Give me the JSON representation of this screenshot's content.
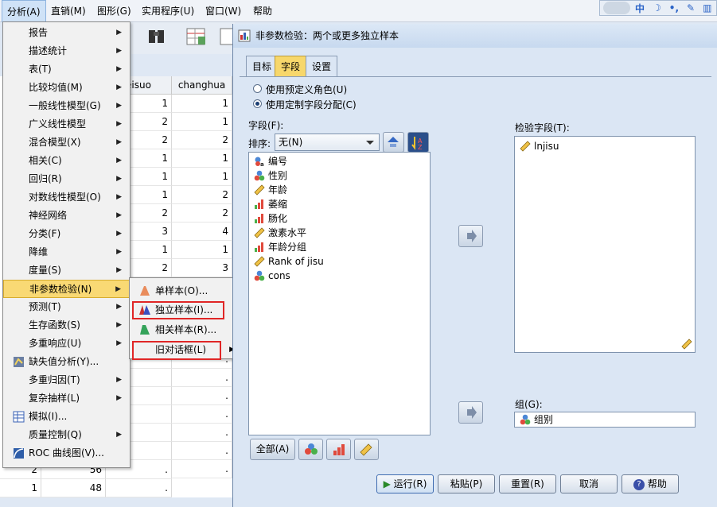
{
  "menubar": {
    "items": [
      "分析(A)",
      "直销(M)",
      "图形(G)",
      "实用程序(U)",
      "窗口(W)",
      "帮助"
    ],
    "ime_text": "中"
  },
  "grid": {
    "headers": [
      "eisuo",
      "changhua"
    ],
    "rows": [
      {
        "a": "1",
        "b": "1"
      },
      {
        "a": "2",
        "b": "1"
      },
      {
        "a": "2",
        "b": "2"
      },
      {
        "a": "1",
        "b": "1"
      },
      {
        "a": "1",
        "b": "1"
      },
      {
        "a": "1",
        "b": "2"
      },
      {
        "a": "2",
        "b": "2"
      },
      {
        "a": "3",
        "b": "4"
      },
      {
        "a": "1",
        "b": "1"
      },
      {
        "a": "2",
        "b": "3"
      },
      {
        "a": "",
        "b": ""
      },
      {
        "a": "",
        "b": ""
      },
      {
        "a": "",
        "b": ""
      },
      {
        "a": "",
        "b": "."
      },
      {
        "a": "",
        "b": "."
      },
      {
        "a": "",
        "b": "."
      },
      {
        "a": "",
        "b": "."
      },
      {
        "a": "",
        "b": "."
      },
      {
        "a": "",
        "b": "."
      },
      {
        "a": "",
        "b": "."
      },
      {
        "a": "",
        "b": "."
      }
    ],
    "bottom_rows": [
      {
        "c0": "2",
        "c1": "56",
        "c2": "."
      },
      {
        "c0": "1",
        "c1": "48",
        "c2": "."
      }
    ]
  },
  "menu": {
    "items": [
      {
        "label": "报告",
        "arrow": true
      },
      {
        "label": "描述统计",
        "arrow": true
      },
      {
        "label": "表(T)",
        "arrow": true
      },
      {
        "label": "比较均值(M)",
        "arrow": true
      },
      {
        "label": "一般线性模型(G)",
        "arrow": true
      },
      {
        "label": "广义线性模型",
        "arrow": true
      },
      {
        "label": "混合模型(X)",
        "arrow": true
      },
      {
        "label": "相关(C)",
        "arrow": true
      },
      {
        "label": "回归(R)",
        "arrow": true
      },
      {
        "label": "对数线性模型(O)",
        "arrow": true
      },
      {
        "label": "神经网络",
        "arrow": true
      },
      {
        "label": "分类(F)",
        "arrow": true
      },
      {
        "label": "降维",
        "arrow": true
      },
      {
        "label": "度量(S)",
        "arrow": true
      },
      {
        "label": "非参数检验(N)",
        "arrow": true,
        "selected": true
      },
      {
        "label": "预测(T)",
        "arrow": true
      },
      {
        "label": "生存函数(S)",
        "arrow": true
      },
      {
        "label": "多重响应(U)",
        "arrow": true
      },
      {
        "label": "缺失值分析(Y)...",
        "arrow": false,
        "icon": "missing-values-icon"
      },
      {
        "label": "多重归因(T)",
        "arrow": true
      },
      {
        "label": "复杂抽样(L)",
        "arrow": true
      },
      {
        "label": "模拟(I)...",
        "arrow": false,
        "icon": "simulation-icon"
      },
      {
        "label": "质量控制(Q)",
        "arrow": true
      },
      {
        "label": "ROC 曲线图(V)...",
        "arrow": false,
        "icon": "roc-curve-icon"
      }
    ]
  },
  "submenu": {
    "items": [
      {
        "label": "单样本(O)...",
        "icon": "one-sample-icon"
      },
      {
        "label": "独立样本(I)...",
        "icon": "independent-samples-icon",
        "highlighted": true
      },
      {
        "label": "相关样本(R)...",
        "icon": "related-samples-icon"
      },
      {
        "label": "旧对话框(L)",
        "arrow": true,
        "highlighted": true
      }
    ]
  },
  "dialog": {
    "title": "非参数检验：两个或更多独立样本",
    "tabs": [
      "目标",
      "字段",
      "设置"
    ],
    "active_tab": "字段",
    "radio_predefined": "使用预定义角色(U)",
    "radio_custom": "使用定制字段分配(C)",
    "fields_label": "字段(F):",
    "sort_label": "排序:",
    "sort_value": "无(N)",
    "fields": [
      {
        "label": "编号",
        "icon": "nominal-ab-icon"
      },
      {
        "label": "性别",
        "icon": "nominal-icon"
      },
      {
        "label": "年龄",
        "icon": "scale-icon"
      },
      {
        "label": "萎缩",
        "icon": "ordinal-icon"
      },
      {
        "label": "肠化",
        "icon": "ordinal-icon"
      },
      {
        "label": "激素水平",
        "icon": "scale-icon"
      },
      {
        "label": "年龄分组",
        "icon": "ordinal-icon"
      },
      {
        "label": "Rank of jisu",
        "icon": "scale-icon"
      },
      {
        "label": "cons",
        "icon": "nominal-icon"
      }
    ],
    "test_fields_label": "检验字段(T):",
    "test_fields": [
      "lnjisu"
    ],
    "group_label": "组(G):",
    "group_value": "组别",
    "all_button": "全部(A)",
    "buttons": {
      "run": "运行(R)",
      "paste": "粘贴(P)",
      "reset": "重置(R)",
      "cancel": "取消",
      "help": "帮助"
    }
  }
}
